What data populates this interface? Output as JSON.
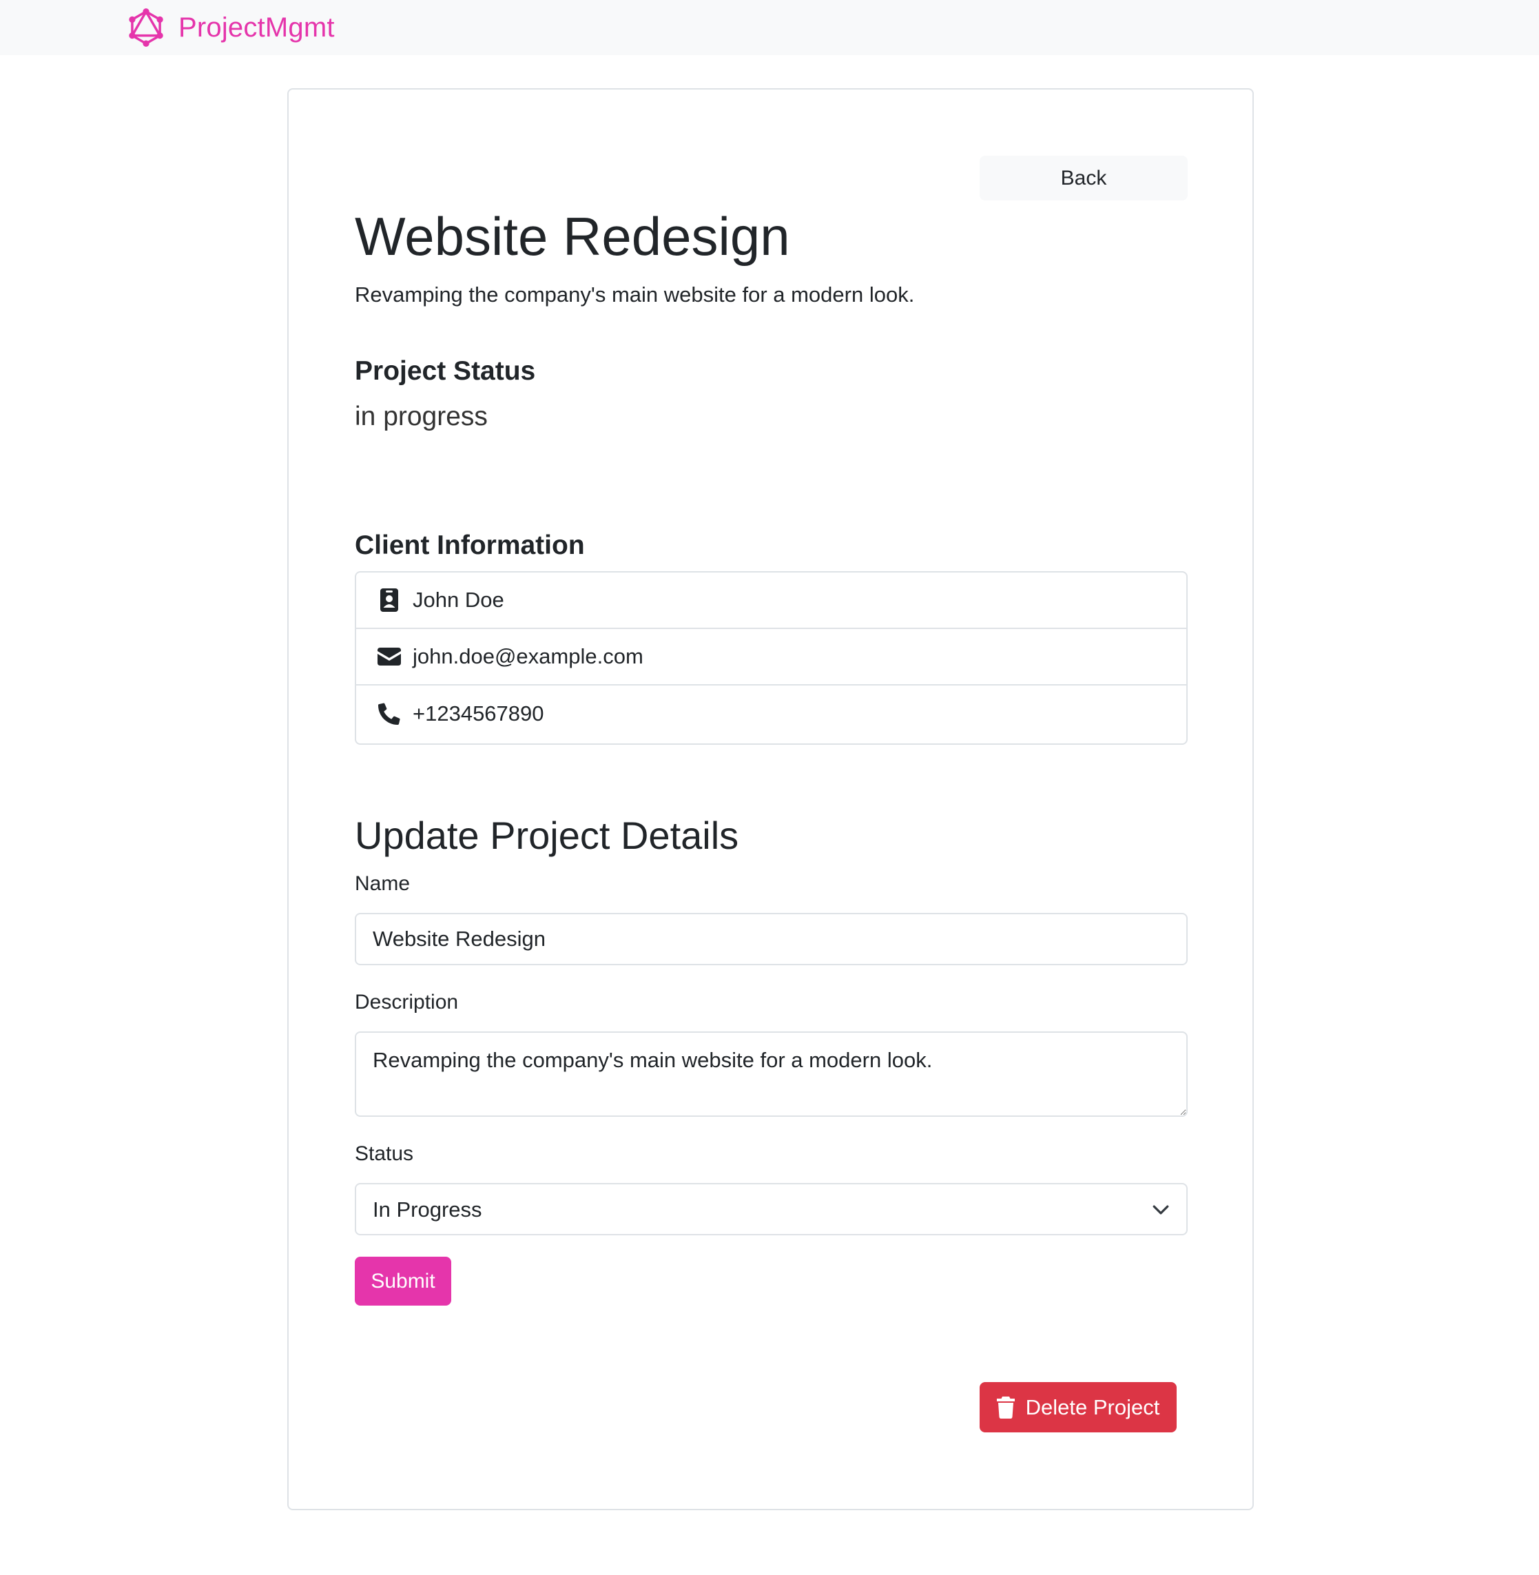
{
  "navbar": {
    "brand": "ProjectMgmt",
    "logo_icon": "graphql-logo-icon",
    "brand_color": "#e535ab"
  },
  "project": {
    "back_label": "Back",
    "name": "Website Redesign",
    "description": "Revamping the company's main website for a modern look.",
    "status_heading": "Project Status",
    "status": "in progress"
  },
  "client": {
    "heading": "Client Information",
    "items": [
      {
        "icon": "id-badge-icon",
        "text": "John Doe"
      },
      {
        "icon": "envelope-icon",
        "text": "john.doe@example.com"
      },
      {
        "icon": "phone-icon",
        "text": "+1234567890"
      }
    ]
  },
  "form": {
    "heading": "Update Project Details",
    "name_label": "Name",
    "name_value": "Website Redesign",
    "description_label": "Description",
    "description_value": "Revamping the company's main website for a modern look.",
    "status_label": "Status",
    "status_selected": "In Progress",
    "submit_label": "Submit"
  },
  "delete": {
    "label": "Delete Project",
    "icon": "trash-icon",
    "color": "#dc3545"
  }
}
